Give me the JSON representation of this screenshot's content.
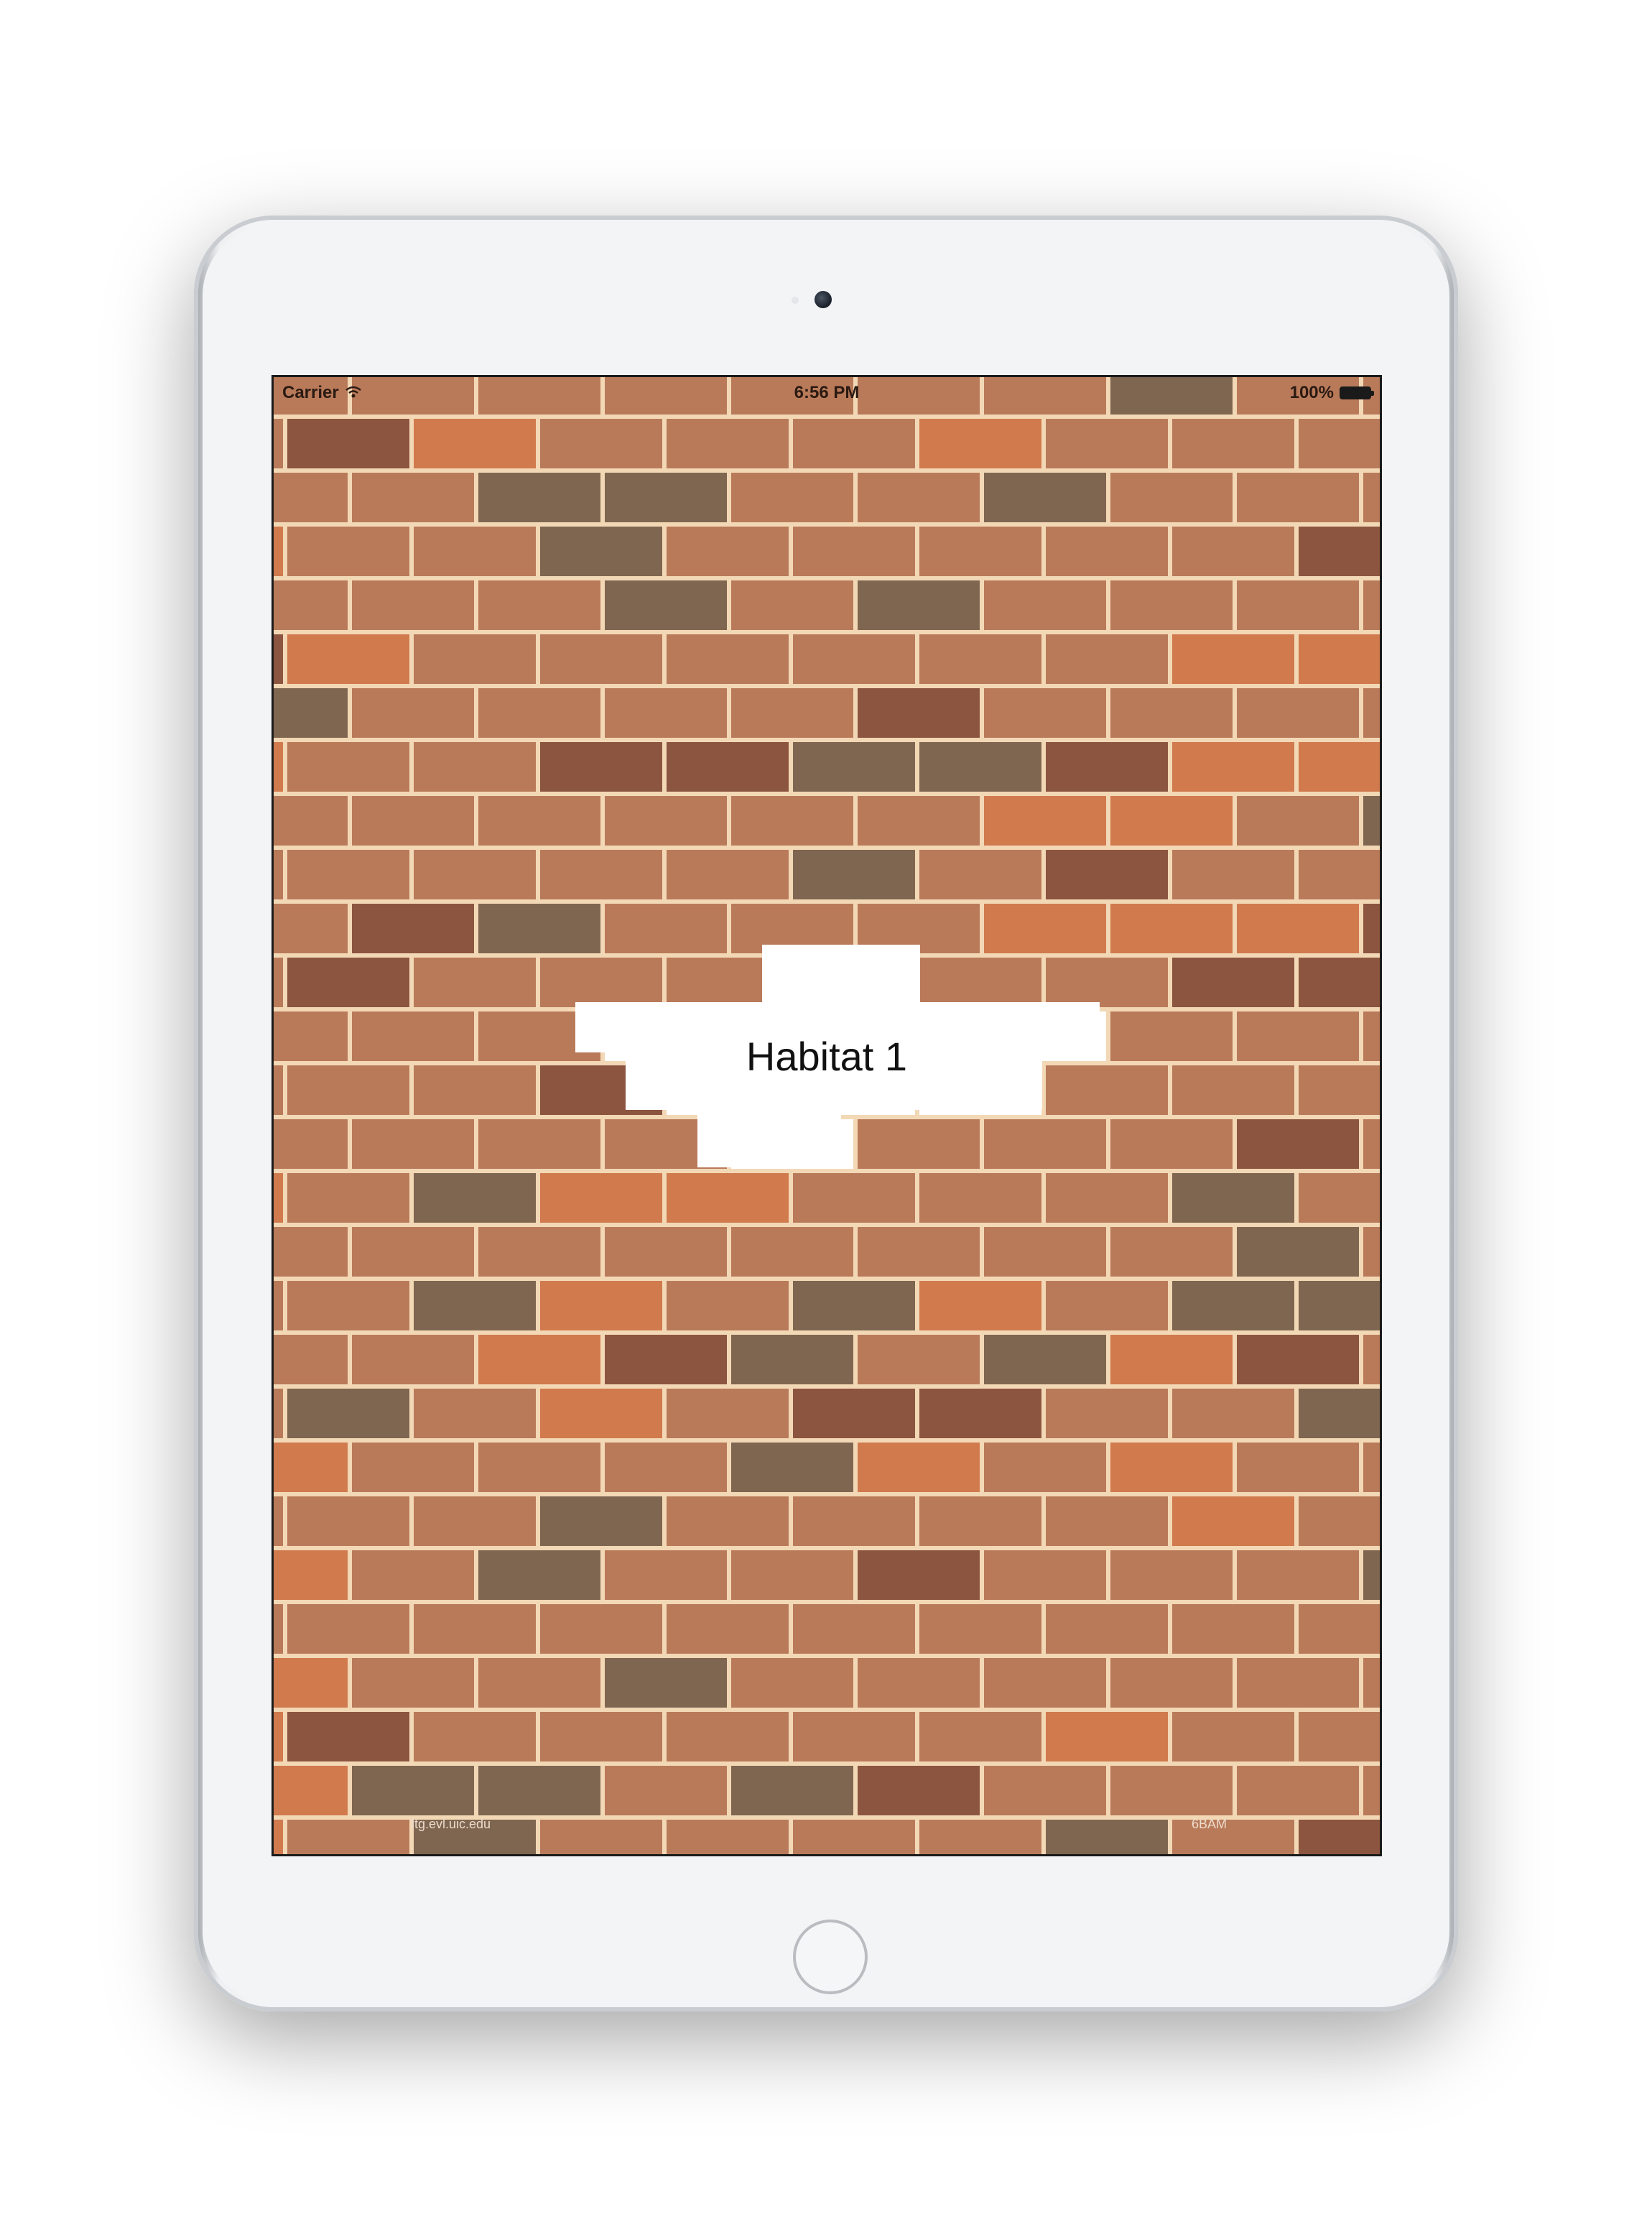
{
  "status_bar": {
    "carrier": "Carrier",
    "wifi_icon": "wifi-icon",
    "time": "6:56 PM",
    "battery_percent": "100%",
    "battery_icon": "battery-full-icon",
    "battery_level": 1.0
  },
  "main": {
    "title": "Habitat 1"
  },
  "footer": {
    "left_text": "ltg.evl.uic.edu",
    "right_text": "6BAM"
  },
  "colors": {
    "mortar": "#f3d8b6",
    "brick_base": "#b97a5a",
    "brick_orange": "#d07a4e",
    "brick_dark": "#8c5540",
    "brick_gray": "#7f6650",
    "opening": "#ffffff"
  }
}
